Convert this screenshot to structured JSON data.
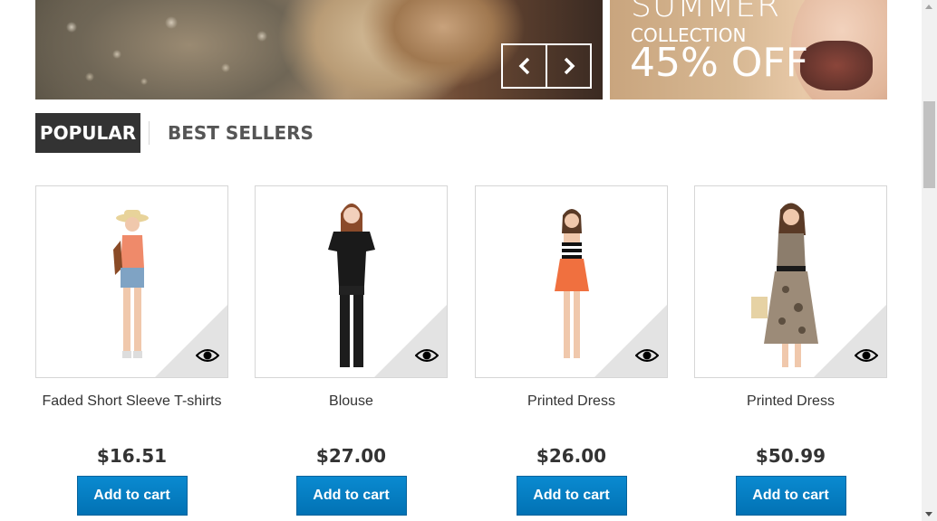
{
  "banner": {
    "promo_line1": "SUMMER",
    "promo_line2": "COLLECTION",
    "promo_line3": "45% OFF"
  },
  "slider_nav": {
    "prev_icon": "chevron-left-icon",
    "next_icon": "chevron-right-icon"
  },
  "tabs": [
    {
      "label": "POPULAR",
      "active": true
    },
    {
      "label": "BEST SELLERS",
      "active": false
    }
  ],
  "products": [
    {
      "name": "Faded Short Sleeve T-shirts",
      "price": "$16.51",
      "button": "Add to cart"
    },
    {
      "name": "Blouse",
      "price": "$27.00",
      "button": "Add to cart"
    },
    {
      "name": "Printed Dress",
      "price": "$26.00",
      "button": "Add to cart"
    },
    {
      "name": "Printed Dress",
      "price": "$50.99",
      "button": "Add to cart"
    }
  ],
  "colors": {
    "accent": "#0a81c6",
    "tab_active_bg": "#333333"
  }
}
